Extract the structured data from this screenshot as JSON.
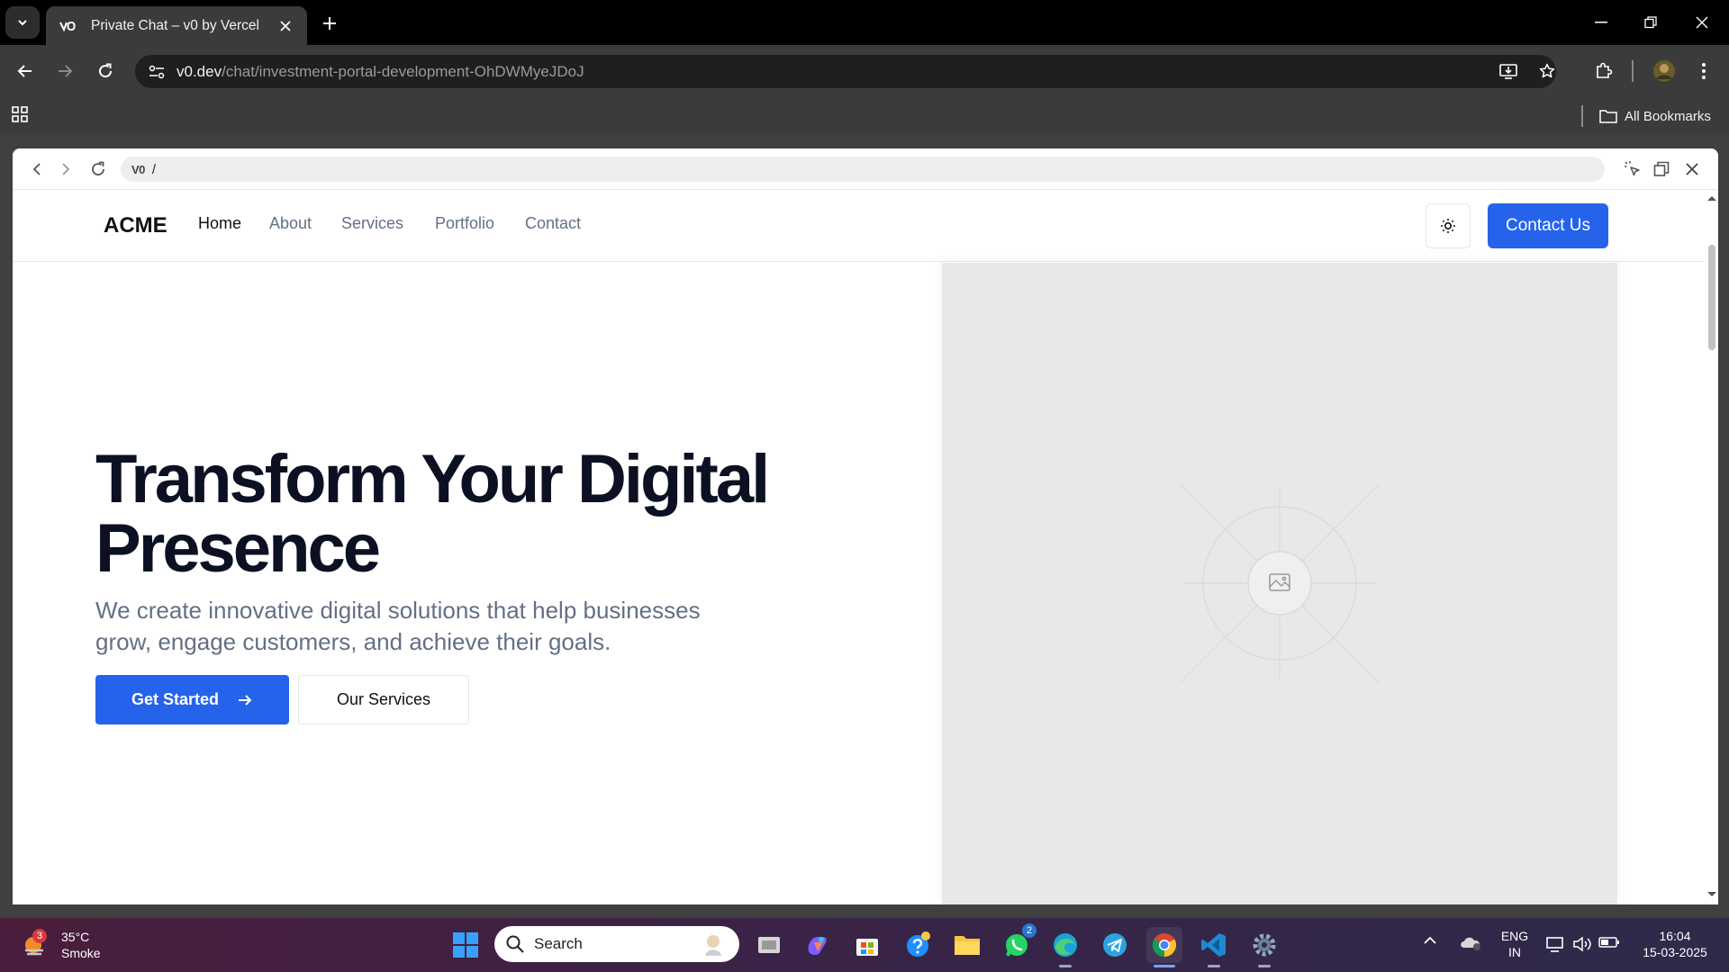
{
  "browser": {
    "tab_title": "Private Chat – v0 by Vercel",
    "url_domain": "v0.dev",
    "url_path": "/chat/investment-portal-development-OhDWMyeJDoJ",
    "bookmarks_label": "All Bookmarks"
  },
  "preview": {
    "logo": "V0",
    "path": "/"
  },
  "site": {
    "brand": "ACME",
    "nav": [
      "Home",
      "About",
      "Services",
      "Portfolio",
      "Contact"
    ],
    "cta": "Contact Us",
    "hero_title_line1": "Transform Your Digital",
    "hero_title_line2": "Presence",
    "hero_text": "We create innovative digital solutions that help businesses grow, engage customers, and achieve their goals.",
    "primary_button": "Get Started",
    "secondary_button": "Our Services",
    "accent_color": "#2563eb"
  },
  "taskbar": {
    "weather_temp": "35°C",
    "weather_desc": "Smoke",
    "weather_badge": "3",
    "search_placeholder": "Search",
    "whatsapp_badge": "2",
    "lang_line1": "ENG",
    "lang_line2": "IN",
    "time": "16:04",
    "date": "15-03-2025"
  }
}
